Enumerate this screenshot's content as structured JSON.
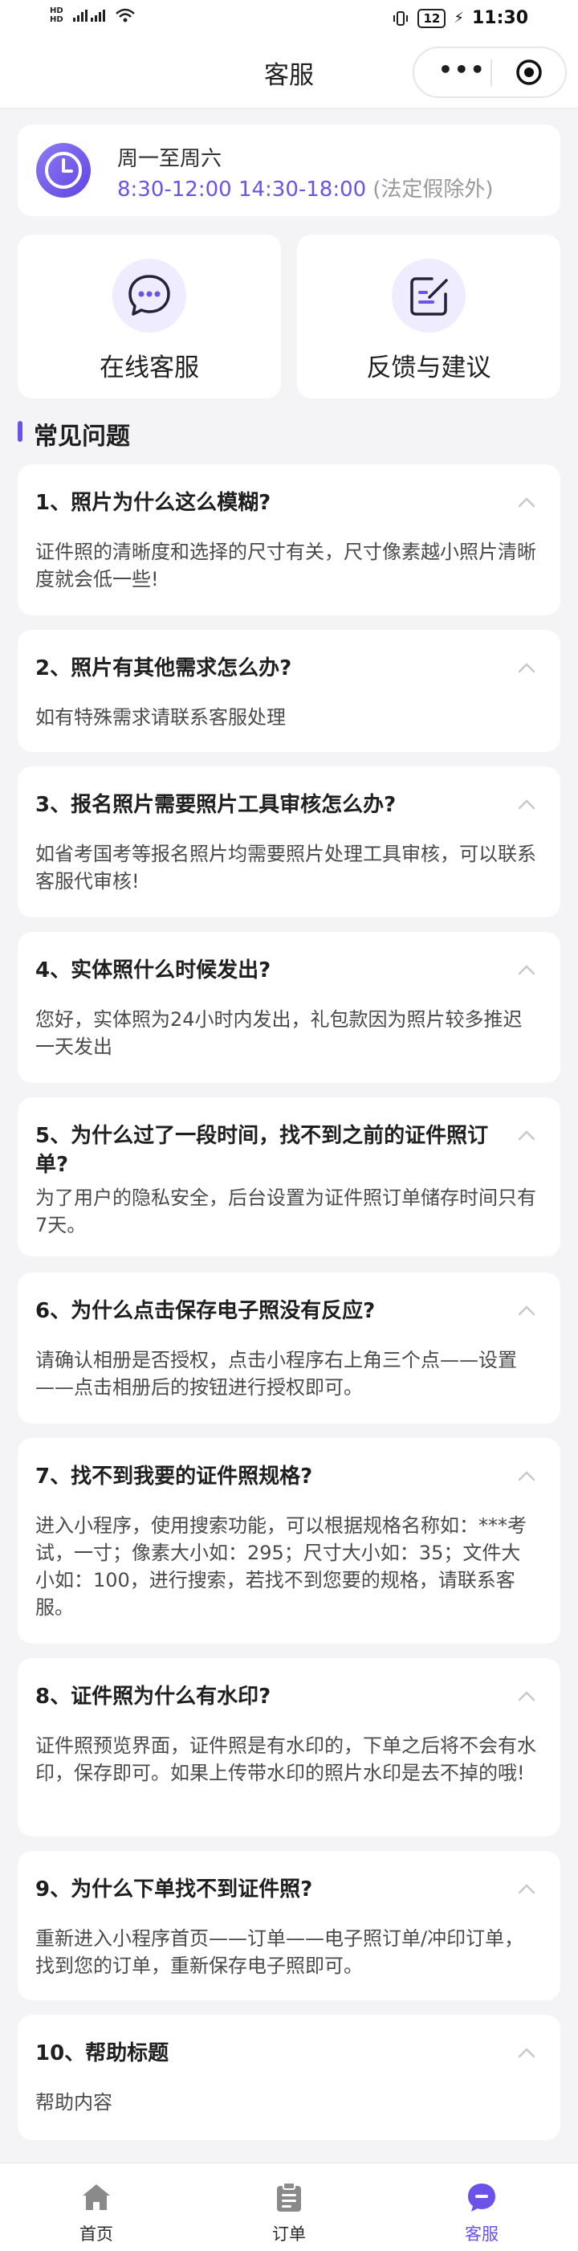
{
  "status_bar": {
    "time": "11:30",
    "battery": "12"
  },
  "nav": {
    "title": "客服"
  },
  "hours": {
    "days": "周一至周六",
    "time": "8:30-12:00 14:30-18:00",
    "note": "(法定假除外)"
  },
  "services": [
    {
      "label": "在线客服",
      "icon": "chat-bubble-icon"
    },
    {
      "label": "反馈与建议",
      "icon": "edit-note-icon"
    }
  ],
  "faq": {
    "heading": "常见问题",
    "items": [
      {
        "q": "1、照片为什么这么模糊?",
        "a": "证件照的清晰度和选择的尺寸有关，尺寸像素越小照片清晰度就会低一些!"
      },
      {
        "q": "2、照片有其他需求怎么办?",
        "a": "如有特殊需求请联系客服处理"
      },
      {
        "q": "3、报名照片需要照片工具审核怎么办?",
        "a": "如省考国考等报名照片均需要照片处理工具审核，可以联系客服代审核!"
      },
      {
        "q": "4、实体照什么时候发出?",
        "a": "您好，实体照为24小时内发出，礼包款因为照片较多推迟一天发出"
      },
      {
        "q": "5、为什么过了一段时间，找不到之前的证件照订单?",
        "a": "为了用户的隐私安全，后台设置为证件照订单储存时间只有7天。"
      },
      {
        "q": "6、为什么点击保存电子照没有反应?",
        "a": "请确认相册是否授权，点击小程序右上角三个点——设置——点击相册后的按钮进行授权即可。"
      },
      {
        "q": "7、找不到我要的证件照规格?",
        "a": "进入小程序，使用搜索功能，可以根据规格名称如：***考试，一寸；像素大小如：295；尺寸大小如：35；文件大小如：100，进行搜索，若找不到您要的规格，请联系客服。"
      },
      {
        "q": "8、证件照为什么有水印?",
        "a": "证件照预览界面，证件照是有水印的，下单之后将不会有水印，保存即可。如果上传带水印的照片水印是去不掉的哦!"
      },
      {
        "q": "9、为什么下单找不到证件照?",
        "a": "重新进入小程序首页——订单——电子照订单/冲印订单，找到您的订单，重新保存电子照即可。"
      },
      {
        "q": "10、帮助标题",
        "a": "帮助内容"
      }
    ]
  },
  "tabs": [
    {
      "label": "首页",
      "icon": "home-icon"
    },
    {
      "label": "订单",
      "icon": "clipboard-icon"
    },
    {
      "label": "客服",
      "icon": "service-chat-icon"
    }
  ],
  "colors": {
    "accent": "#6C52E8",
    "accent_light": "#EFECFF",
    "page_bg": "#F4F4F6",
    "tab_inactive": "#8A8A8A"
  }
}
